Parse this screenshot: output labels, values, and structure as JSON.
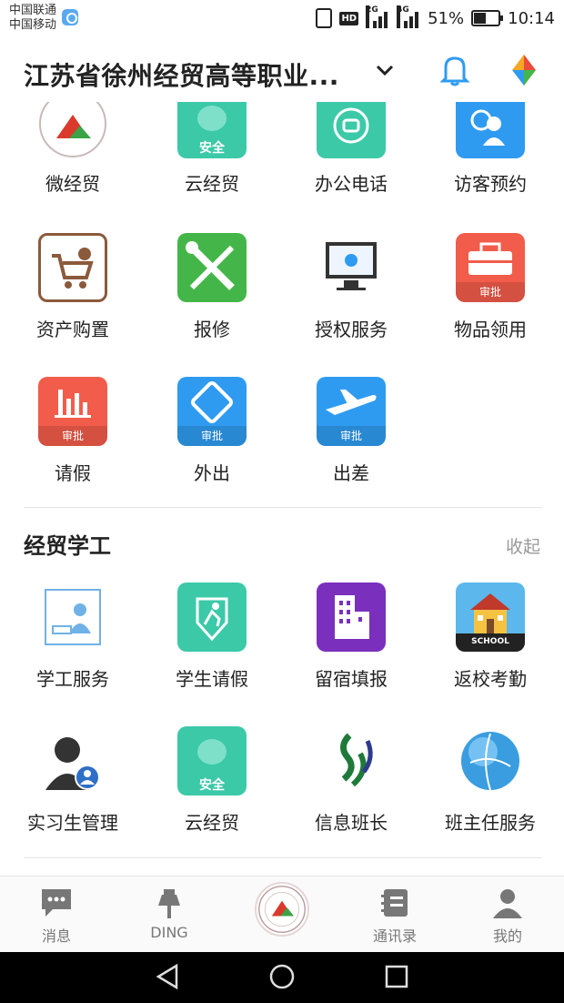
{
  "status": {
    "carrier1": "中国联通",
    "carrier2": "中国移动",
    "hd": "HD",
    "net1": "2G",
    "net2": "4G",
    "battery": "51%",
    "battery_level": 0.51,
    "time": "10:14"
  },
  "header": {
    "title": "江苏省徐州经贸高等职业..."
  },
  "apps": [
    {
      "label": "微经贸",
      "icon": "school-logo-icon"
    },
    {
      "label": "云经贸",
      "icon": "cloud-safe-icon",
      "badge": "安全"
    },
    {
      "label": "办公电话",
      "icon": "phone-icon"
    },
    {
      "label": "访客预约",
      "icon": "visitor-icon"
    },
    {
      "label": "资产购置",
      "icon": "cart-icon"
    },
    {
      "label": "报修",
      "icon": "tools-icon"
    },
    {
      "label": "授权服务",
      "icon": "monitor-icon"
    },
    {
      "label": "物品领用",
      "icon": "toolbox-icon",
      "badge": "审批"
    },
    {
      "label": "请假",
      "icon": "chart-bars-icon",
      "badge": "审批"
    },
    {
      "label": "外出",
      "icon": "handshake-icon",
      "badge": "审批"
    },
    {
      "label": "出差",
      "icon": "plane-icon",
      "badge": "审批"
    }
  ],
  "section2": {
    "title": "经贸学工",
    "collapse": "收起",
    "items": [
      {
        "label": "学工服务",
        "icon": "study-service-icon"
      },
      {
        "label": "学生请假",
        "icon": "runner-icon"
      },
      {
        "label": "留宿填报",
        "icon": "building-icon"
      },
      {
        "label": "返校考勤",
        "icon": "school-house-icon",
        "caption": "SCHOOL"
      },
      {
        "label": "实习生管理",
        "icon": "intern-icon"
      },
      {
        "label": "云经贸",
        "icon": "cloud-safe-icon",
        "badge": "安全"
      },
      {
        "label": "信息班长",
        "icon": "swirl-logo-icon"
      },
      {
        "label": "班主任服务",
        "icon": "globe-icon"
      }
    ]
  },
  "tabs": [
    {
      "label": "消息",
      "icon": "message-icon"
    },
    {
      "label": "DING",
      "icon": "pin-icon"
    },
    {
      "label": "",
      "icon": "school-logo-icon"
    },
    {
      "label": "通讯录",
      "icon": "contacts-icon"
    },
    {
      "label": "我的",
      "icon": "person-icon"
    }
  ],
  "colors": {
    "blue": "#2f9bf0",
    "teal": "#3cc9a8",
    "green": "#44b649",
    "red": "#f25c4b",
    "purple": "#7b2fbd",
    "brown": "#8b5a3c",
    "gray_text": "#999999"
  }
}
